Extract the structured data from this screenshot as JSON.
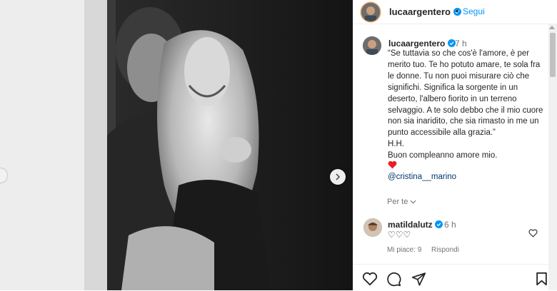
{
  "post": {
    "author": "lucaargentero",
    "follow_label": "Segui",
    "separator": "•",
    "time": "7 h",
    "caption": "“Se tuttavia so che cos'è l'amore, è per merito tuo. Te ho potuto amare, te sola fra le donne. Tu non puoi misurare ciò che significhi. Significa la sorgente in un deserto, l'albero fiorito in un terreno selvaggio. A te solo debbo che il mio cuore non sia inaridito, che sia rimasto in me un punto accessibile alla grazia.”\nH.H.\nBuon compleanno amore mio.",
    "mention": "@cristina__marino",
    "for_you_label": "Per te"
  },
  "comment": {
    "author": "matildalutz",
    "time": "6 h",
    "text": "♡♡♡",
    "likes": "Mi piace: 9",
    "reply_label": "Rispondi"
  },
  "colors": {
    "accent_blue": "#0095f6",
    "verified_blue": "#0095f6",
    "heart_red": "#ed1c24",
    "mention_blue": "#00376b"
  },
  "icons": [
    "verified-badge-icon",
    "chevron-right-icon",
    "chevron-down-icon",
    "heart-icon",
    "comment-icon",
    "share-icon",
    "bookmark-icon"
  ]
}
